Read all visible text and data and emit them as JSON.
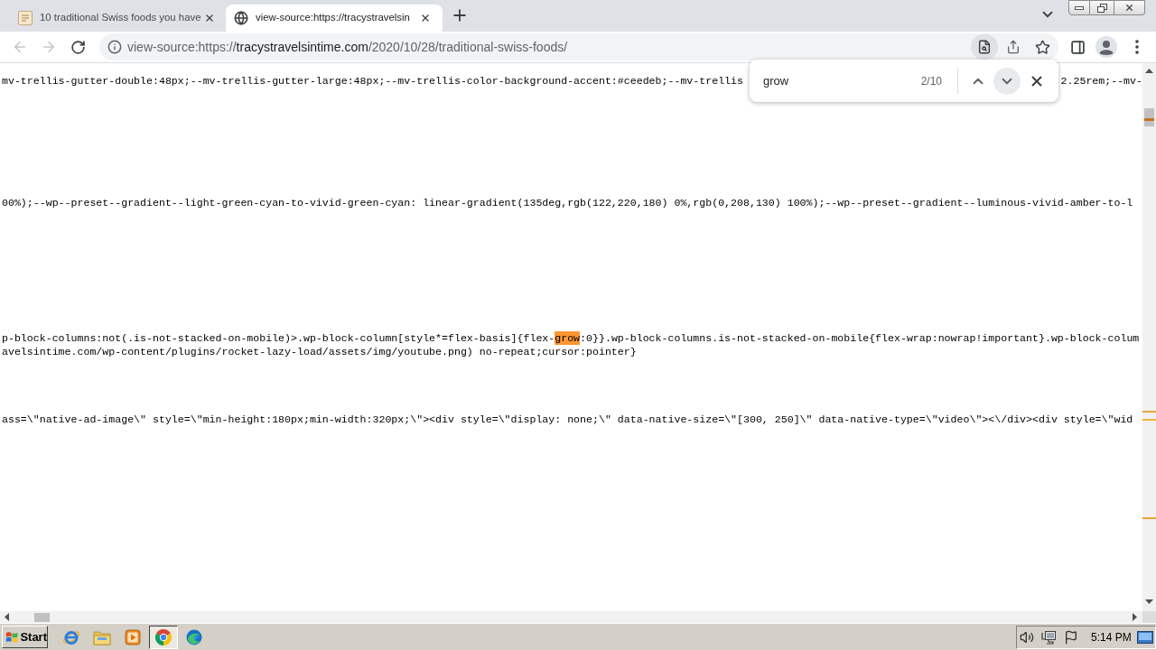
{
  "tabs": [
    {
      "title": "10 traditional Swiss foods you have",
      "selected": false
    },
    {
      "title": "view-source:https://tracystravelsin",
      "selected": true
    }
  ],
  "toolbar": {
    "back_disabled": true,
    "forward_disabled": true
  },
  "address_bar": {
    "scheme": "view-source:https://",
    "host": "tracystravelsintime.com",
    "path": "/2020/10/28/traditional-swiss-foods/"
  },
  "find_bar": {
    "query": "grow",
    "count": "2/10"
  },
  "source_lines": [
    {
      "segments": [
        {
          "kind": "text",
          "text": "mv-trellis-gutter-double:48px;--mv-trellis-gutter-large:48px;--mv-trellis-color-background-accent:#ceedeb;--mv-trellis"
        }
      ],
      "trailing": "2.25rem;--mv-"
    },
    {
      "segments": [
        {
          "kind": "text",
          "text": "00%);--wp--preset--gradient--light-green-cyan-to-vivid-green-cyan: linear-gradient(135deg,rgb(122,220,180) 0%,rgb(0,208,130) 100%);--wp--preset--gradient--luminous-vivid-amber-to-l"
        }
      ]
    },
    {
      "segments": [
        {
          "kind": "text",
          "text": "p-block-columns:not(.is-not-stacked-on-mobile)>.wp-block-column[style*=flex-basis]{flex-"
        },
        {
          "kind": "match",
          "text": "grow",
          "current": true
        },
        {
          "kind": "text",
          "text": ":0}}.wp-block-columns.is-not-stacked-on-mobile{flex-wrap:nowrap!important}.wp-block-colum"
        }
      ]
    },
    {
      "segments": [
        {
          "kind": "text",
          "text": "avelsintime.com/wp-content/plugins/rocket-lazy-load/assets/img/youtube.png) no-repeat;cursor:pointer}"
        }
      ]
    },
    {
      "segments": [
        {
          "kind": "text",
          "text": "ass=\\\"native-ad-image\\\" style=\\\"min-height:180px;min-width:320px;\\\"><div style=\\\"display: none;\\\" data-native-size=\\\"[300, 250]\\\" data-native-type=\\\"video\\\"><\\/div><div style=\\\"wid"
        }
      ]
    }
  ],
  "taskbar": {
    "start_label": "Start",
    "pinned": [
      {
        "selected": false
      },
      {
        "selected": false
      },
      {
        "selected": false
      },
      {
        "selected": true
      },
      {
        "selected": false
      }
    ],
    "clock": "5:14 PM"
  }
}
